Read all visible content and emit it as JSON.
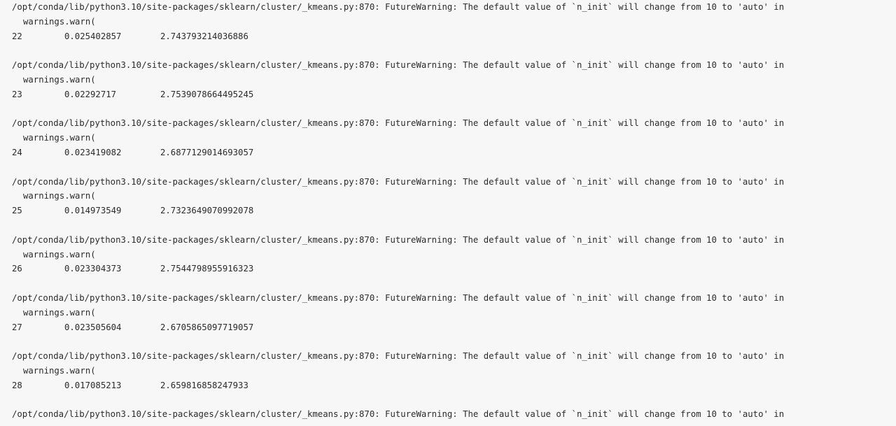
{
  "console": {
    "blocks": [
      {
        "warning": "/opt/conda/lib/python3.10/site-packages/sklearn/cluster/_kmeans.py:870: FutureWarning: The default value of `n_init` will change from 10 to 'auto' in",
        "call": "warnings.warn(",
        "row": {
          "k": "22",
          "a": "0.025402857",
          "b": "2.743793214036886"
        }
      },
      {
        "warning": "/opt/conda/lib/python3.10/site-packages/sklearn/cluster/_kmeans.py:870: FutureWarning: The default value of `n_init` will change from 10 to 'auto' in",
        "call": "warnings.warn(",
        "row": {
          "k": "23",
          "a": "0.02292717",
          "b": "2.7539078664495245"
        }
      },
      {
        "warning": "/opt/conda/lib/python3.10/site-packages/sklearn/cluster/_kmeans.py:870: FutureWarning: The default value of `n_init` will change from 10 to 'auto' in",
        "call": "warnings.warn(",
        "row": {
          "k": "24",
          "a": "0.023419082",
          "b": "2.6877129014693057"
        }
      },
      {
        "warning": "/opt/conda/lib/python3.10/site-packages/sklearn/cluster/_kmeans.py:870: FutureWarning: The default value of `n_init` will change from 10 to 'auto' in",
        "call": "warnings.warn(",
        "row": {
          "k": "25",
          "a": "0.014973549",
          "b": "2.7323649070992078"
        }
      },
      {
        "warning": "/opt/conda/lib/python3.10/site-packages/sklearn/cluster/_kmeans.py:870: FutureWarning: The default value of `n_init` will change from 10 to 'auto' in",
        "call": "warnings.warn(",
        "row": {
          "k": "26",
          "a": "0.023304373",
          "b": "2.7544798955916323"
        }
      },
      {
        "warning": "/opt/conda/lib/python3.10/site-packages/sklearn/cluster/_kmeans.py:870: FutureWarning: The default value of `n_init` will change from 10 to 'auto' in",
        "call": "warnings.warn(",
        "row": {
          "k": "27",
          "a": "0.023505604",
          "b": "2.6705865097719057"
        }
      },
      {
        "warning": "/opt/conda/lib/python3.10/site-packages/sklearn/cluster/_kmeans.py:870: FutureWarning: The default value of `n_init` will change from 10 to 'auto' in",
        "call": "warnings.warn(",
        "row": {
          "k": "28",
          "a": "0.017085213",
          "b": "2.659816858247933"
        }
      }
    ],
    "trailing_warning": "/opt/conda/lib/python3.10/site-packages/sklearn/cluster/_kmeans.py:870: FutureWarning: The default value of `n_init` will change from 10 to 'auto' in"
  },
  "colors": {
    "background": "#f7f7f7",
    "text": "#2b2b2b"
  }
}
